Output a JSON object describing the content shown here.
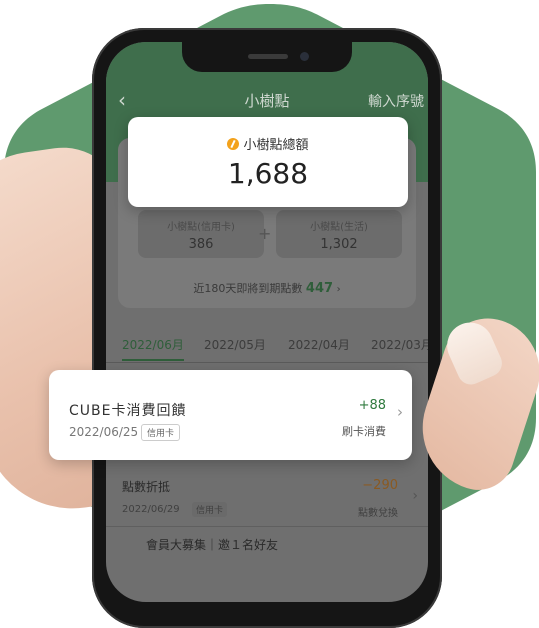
{
  "colors": {
    "brand_green": "#3f6e4c",
    "positive": "#2f7a3e",
    "negative": "#8a5a22",
    "coin": "#f3a21c"
  },
  "nav": {
    "back_icon": "chevron-left-icon",
    "title": "小樹點",
    "right_action": "輸入序號"
  },
  "total": {
    "icon": "coin-icon",
    "label": "小樹點總額",
    "value": "1,688"
  },
  "breakdown": {
    "credit_label": "小樹點(信用卡)",
    "credit_value": "386",
    "plus": "+",
    "life_label": "小樹點(生活)",
    "life_value": "1,302"
  },
  "expiring": {
    "label": "近180天即將到期點數",
    "value": "447"
  },
  "month_tabs": [
    "2022/06月",
    "2022/05月",
    "2022/04月",
    "2022/03月"
  ],
  "highlight_item": {
    "title": "CUBE卡消費回饋",
    "date": "2022/06/25",
    "tag": "信用卡",
    "amount": "+88",
    "type": "刷卡消費"
  },
  "items": [
    {
      "title": "點數折抵",
      "date": "2022/06/29",
      "tag": "信用卡",
      "amount": "−290",
      "type": "點數兌換"
    }
  ],
  "last_row": {
    "title": "會員大募集｜邀１名好友"
  }
}
